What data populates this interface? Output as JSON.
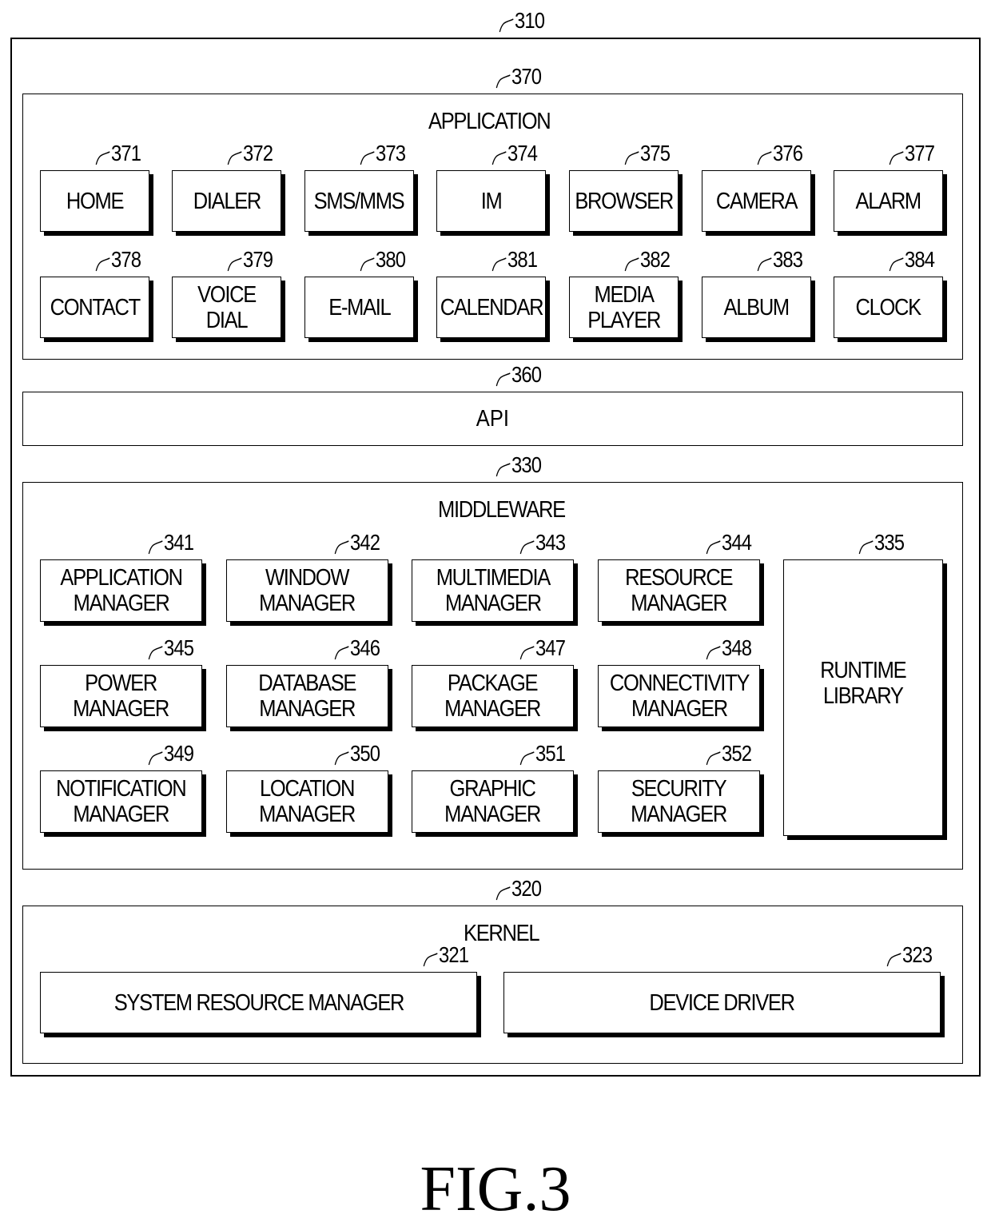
{
  "diagram": {
    "outer": {
      "ref": "310"
    },
    "application": {
      "ref": "370",
      "title": "APPLICATION",
      "items": [
        {
          "ref": "371",
          "label": "HOME"
        },
        {
          "ref": "372",
          "label": "DIALER"
        },
        {
          "ref": "373",
          "label": "SMS/MMS"
        },
        {
          "ref": "374",
          "label": "IM"
        },
        {
          "ref": "375",
          "label": "BROWSER"
        },
        {
          "ref": "376",
          "label": "CAMERA"
        },
        {
          "ref": "377",
          "label": "ALARM"
        },
        {
          "ref": "378",
          "label": "CONTACT"
        },
        {
          "ref": "379",
          "label": "VOICE DIAL"
        },
        {
          "ref": "380",
          "label": "E-MAIL"
        },
        {
          "ref": "381",
          "label": "CALENDAR"
        },
        {
          "ref": "382",
          "label": "MEDIA\nPLAYER"
        },
        {
          "ref": "383",
          "label": "ALBUM"
        },
        {
          "ref": "384",
          "label": "CLOCK"
        }
      ]
    },
    "api": {
      "ref": "360",
      "title": "API"
    },
    "middleware": {
      "ref": "330",
      "title": "MIDDLEWARE",
      "items": [
        {
          "ref": "341",
          "label": "APPLICATION\nMANAGER"
        },
        {
          "ref": "342",
          "label": "WINDOW\nMANAGER"
        },
        {
          "ref": "343",
          "label": "MULTIMEDIA\nMANAGER"
        },
        {
          "ref": "344",
          "label": "RESOURCE\nMANAGER"
        },
        {
          "ref": "345",
          "label": "POWER\nMANAGER"
        },
        {
          "ref": "346",
          "label": "DATABASE\nMANAGER"
        },
        {
          "ref": "347",
          "label": "PACKAGE\nMANAGER"
        },
        {
          "ref": "348",
          "label": "CONNECTIVITY\nMANAGER"
        },
        {
          "ref": "349",
          "label": "NOTIFICATION\nMANAGER"
        },
        {
          "ref": "350",
          "label": "LOCATION\nMANAGER"
        },
        {
          "ref": "351",
          "label": "GRAPHIC\nMANAGER"
        },
        {
          "ref": "352",
          "label": "SECURITY\nMANAGER"
        }
      ],
      "runtime": {
        "ref": "335",
        "label": "RUNTIME\nLIBRARY"
      }
    },
    "kernel": {
      "ref": "320",
      "title": "KERNEL",
      "items": [
        {
          "ref": "321",
          "label": "SYSTEM RESOURCE MANAGER"
        },
        {
          "ref": "323",
          "label": "DEVICE DRIVER"
        }
      ]
    },
    "figure_label": "FIG.3"
  }
}
